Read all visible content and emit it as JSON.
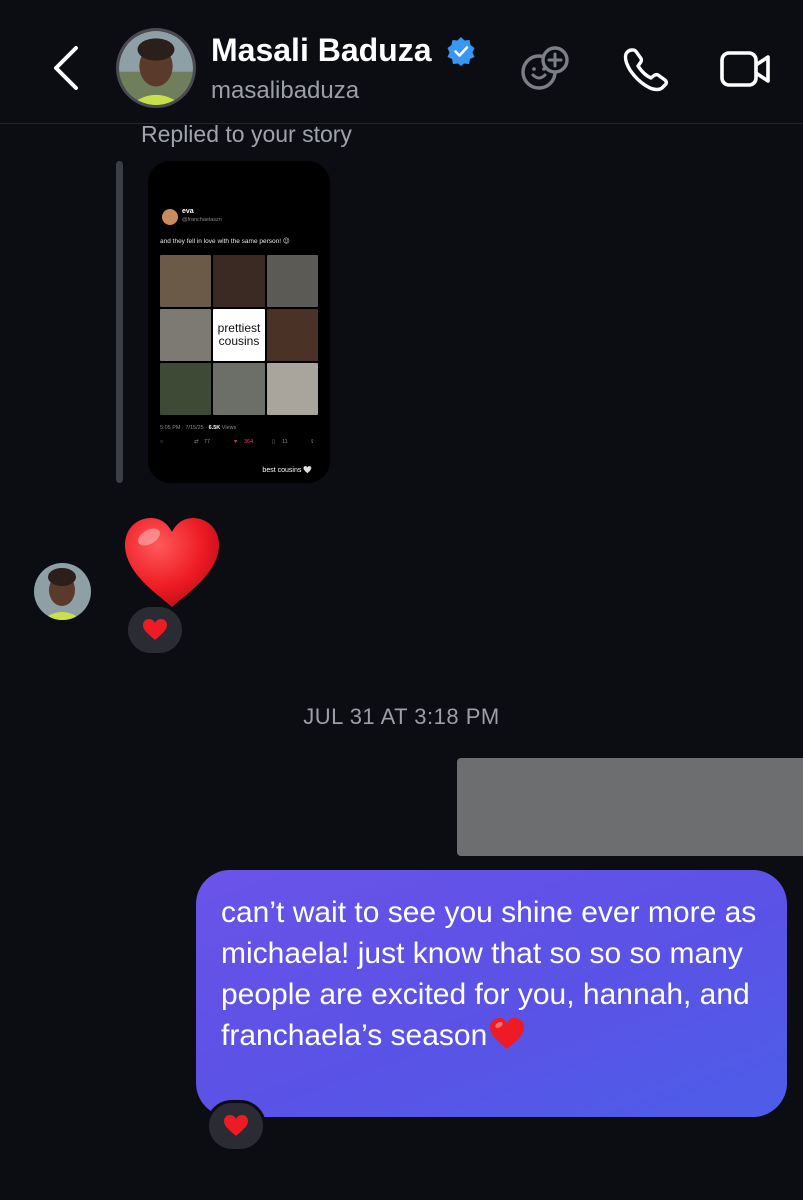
{
  "header": {
    "name": "Masali Baduza",
    "handle": "masalibaduza",
    "verified_color": "#3897f0"
  },
  "icons": {
    "back": "chevron-left-icon",
    "effects": "sticker-add-icon",
    "call": "phone-icon",
    "video": "video-camera-icon"
  },
  "story_reply": {
    "label": "Replied to your story",
    "post": {
      "author": "eva",
      "handle": "@franchaelaszn",
      "text": "and they fell in love with the same person! 😉",
      "center_line1": "prettiest",
      "center_line2": "cousins",
      "time": "5:05 PM · 7/15/25 ·",
      "views_count": "6.5K",
      "views_label": "Views",
      "reposts": "77",
      "likes": "364",
      "bookmarks": "11",
      "caption": "best cousins 🤍"
    }
  },
  "incoming": {
    "message_emoji": "❤️",
    "reaction": "❤️"
  },
  "timestamp": "JUL 31 AT 3:18 PM",
  "outgoing": {
    "text": "can’t wait to see you shine ever more as michaela! just know that so so so many people are excited for you, hannah, and franchaela’s season",
    "inline_emoji": "❤️",
    "reaction": "❤️",
    "bubble_colors": [
      "#6b53e8",
      "#4d5ee8"
    ]
  }
}
